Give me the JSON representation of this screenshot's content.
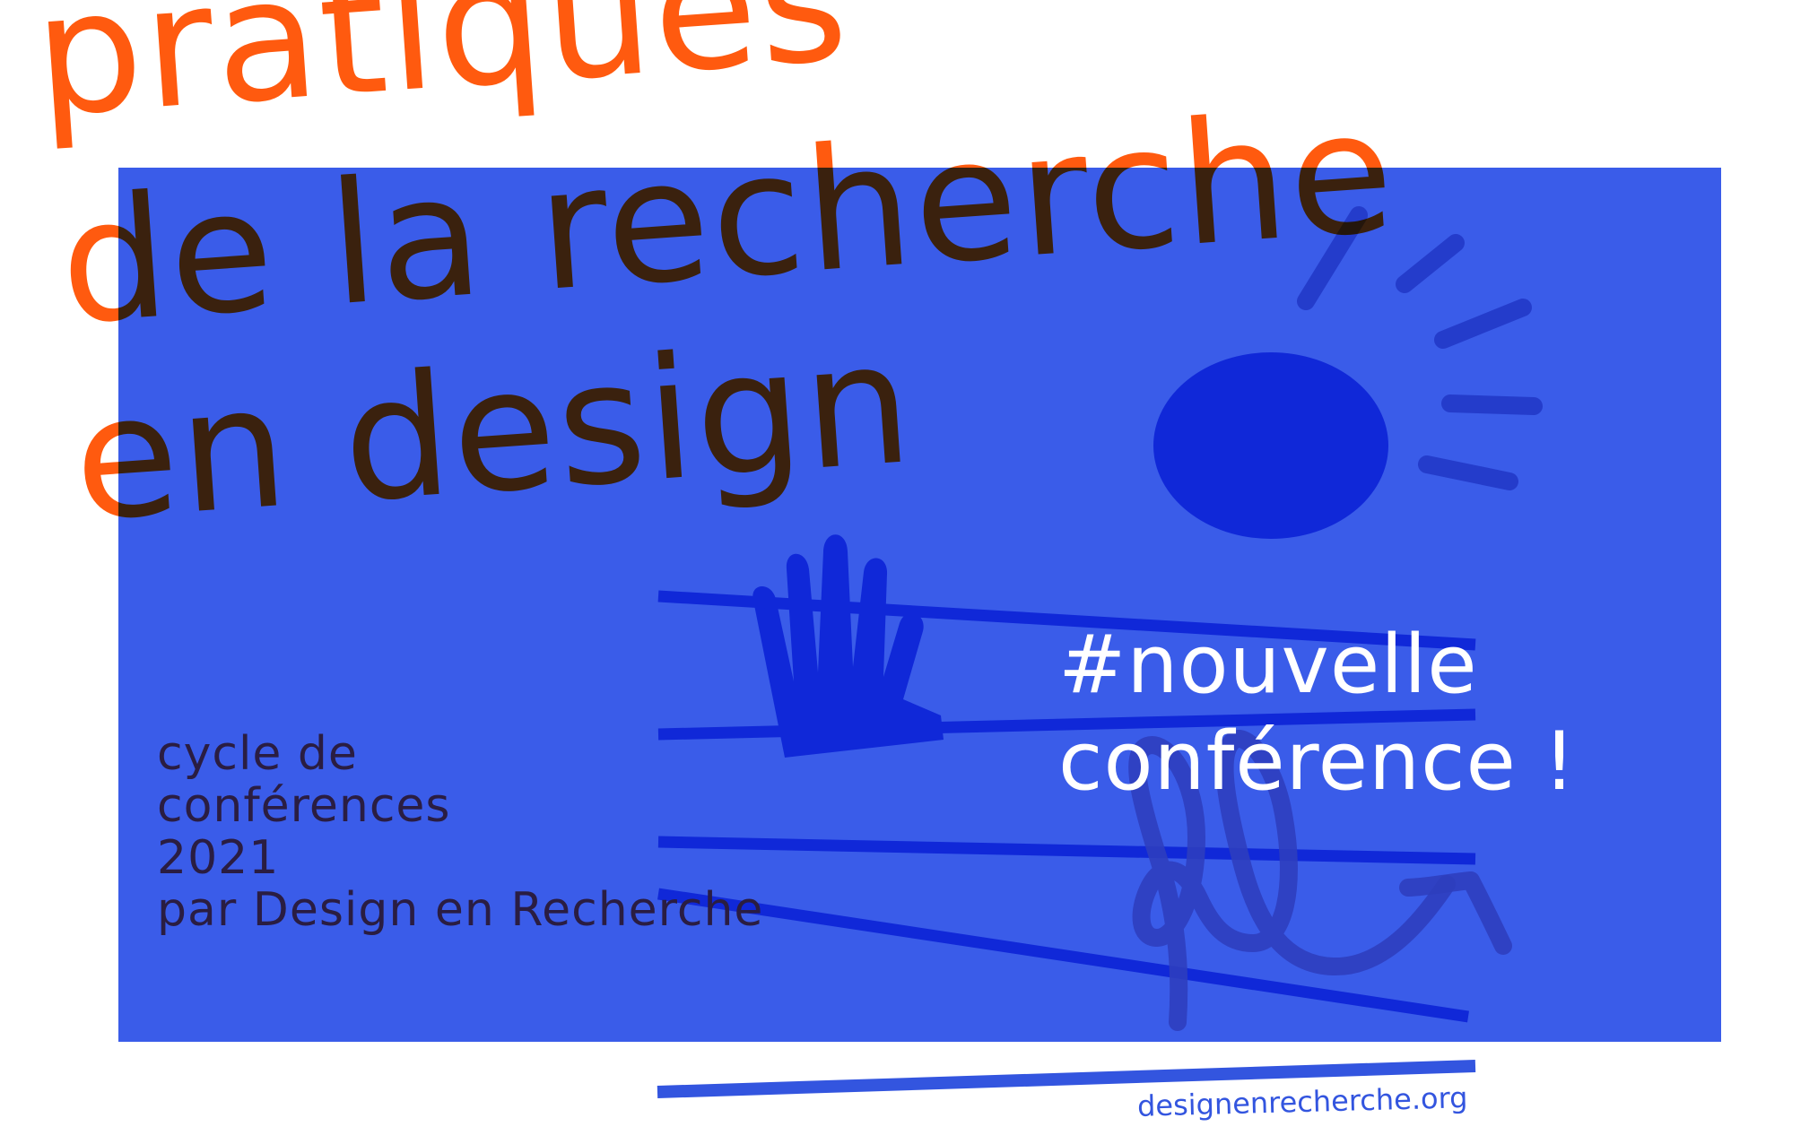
{
  "headline": {
    "line1": "pratiques",
    "line2": "de la recherche",
    "line3": "en design"
  },
  "cycle_text": {
    "line1": "cycle de",
    "line2": "conférences",
    "line3": "2021",
    "line4": "par Design en Recherche"
  },
  "announcement": {
    "line1": "#nouvelle",
    "line2": "conférence !"
  },
  "website": "designenrecherche.org",
  "colors": {
    "background": "#ffffff",
    "panel_blue": "#3a5ce9",
    "dark_blue_shapes": "#1028d8",
    "headline_orange": "#ff5a0f",
    "overlap_brown": "#3a2210",
    "cycle_text_dark": "#2a1d42",
    "announcement_white": "#ffffff",
    "website_blue": "#3355df"
  },
  "icons": [
    "sun-icon",
    "hand-icon",
    "loop-arrow-icon"
  ]
}
